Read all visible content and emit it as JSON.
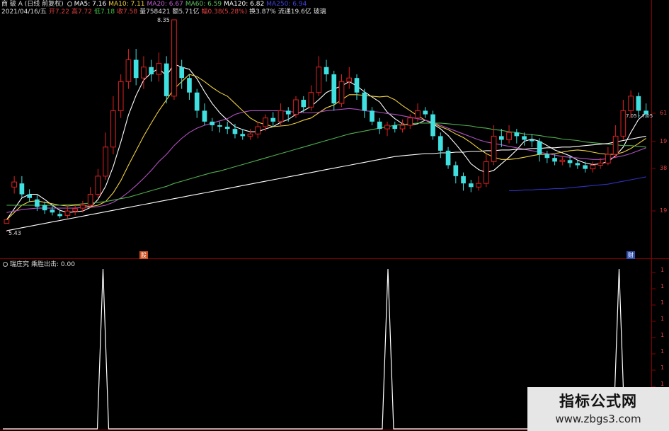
{
  "colors": {
    "background": "#000000",
    "grid": "#8b0000",
    "up": "#e02020",
    "down": "#40e0e0",
    "ma5": "#ffffff",
    "ma10": "#f0d040",
    "ma20": "#b050c0",
    "ma60": "#50b050",
    "ma120": "#ffffff",
    "ma_extra": "#3030c0",
    "indicator_line": "#ffffff"
  },
  "header": {
    "stock_name": "商 破 A (日线 前复权)",
    "ma5_label": "MA5: 7.16",
    "ma10_label": "MA10: 7.11",
    "ma20_label": "MA20: 6.67",
    "ma60_label": "MA60: 6.59",
    "ma120_label": "MA120: 6.82",
    "ma250_label": "MA250: 6.94"
  },
  "info_bar": {
    "date": "2021/04/16/五",
    "open": "开7.22",
    "high": "高7.72",
    "low": "低7.18",
    "close": "收7.58",
    "volume": "量758421",
    "amount": "额5.71亿",
    "change": "幅0.38(5.28%)",
    "turnover": "换3.87%",
    "float_cap": "流通19.6亿",
    "tag": "玻璃"
  },
  "chart_annotations": {
    "high_price": "8.35",
    "low_price": "5.43",
    "cursor_price": "7.05",
    "cursor_price_2": "7.05",
    "marker_left": "股",
    "marker_right": "财"
  },
  "price_axis": {
    "labels": [
      "61",
      "19",
      "38",
      "19"
    ]
  },
  "indicator": {
    "title": "瑞庄究",
    "sub_label": "乘胜出击: 0.00",
    "axis_labels": [
      "1",
      "1",
      "1",
      "1",
      "1",
      "1",
      "1",
      "1",
      "0"
    ]
  },
  "chart_data": {
    "type": "candlestick",
    "y_high": 8.35,
    "y_low": 5.43,
    "candles": [
      [
        5.55,
        5.6,
        5.45,
        5.43
      ],
      [
        6.05,
        6.12,
        6.2,
        5.96
      ],
      [
        6.1,
        5.95,
        6.2,
        5.9
      ],
      [
        5.95,
        5.9,
        6.02,
        5.85
      ],
      [
        5.88,
        5.78,
        5.95,
        5.72
      ],
      [
        5.8,
        5.73,
        5.85,
        5.68
      ],
      [
        5.74,
        5.7,
        5.8,
        5.66
      ],
      [
        5.68,
        5.65,
        5.74,
        5.62
      ],
      [
        5.66,
        5.72,
        5.78,
        5.62
      ],
      [
        5.72,
        5.75,
        5.8,
        5.66
      ],
      [
        5.76,
        5.8,
        5.86,
        5.7
      ],
      [
        5.8,
        5.95,
        6.05,
        5.78
      ],
      [
        5.95,
        6.2,
        6.3,
        5.9
      ],
      [
        6.2,
        6.6,
        6.8,
        6.15
      ],
      [
        6.6,
        7.1,
        7.3,
        6.5
      ],
      [
        7.1,
        7.5,
        7.6,
        7.0
      ],
      [
        7.5,
        7.8,
        7.95,
        7.4
      ],
      [
        7.8,
        7.55,
        7.95,
        7.45
      ],
      [
        7.55,
        7.7,
        7.85,
        7.4
      ],
      [
        7.7,
        7.6,
        7.8,
        7.5
      ],
      [
        7.6,
        7.75,
        7.9,
        7.5
      ],
      [
        7.75,
        7.3,
        7.85,
        7.2
      ],
      [
        7.3,
        8.35,
        8.35,
        7.25
      ],
      [
        7.7,
        7.55,
        7.8,
        7.4
      ],
      [
        7.55,
        7.35,
        7.6,
        7.25
      ],
      [
        7.35,
        7.1,
        7.4,
        7.0
      ],
      [
        7.1,
        6.95,
        7.2,
        6.9
      ],
      [
        6.95,
        6.9,
        7.0,
        6.82
      ],
      [
        6.9,
        6.88,
        6.95,
        6.8
      ],
      [
        6.88,
        6.85,
        6.95,
        6.78
      ],
      [
        6.85,
        6.78,
        6.92,
        6.72
      ],
      [
        6.78,
        6.75,
        6.85,
        6.7
      ],
      [
        6.75,
        6.78,
        6.85,
        6.7
      ],
      [
        6.78,
        6.88,
        6.95,
        6.72
      ],
      [
        6.88,
        7.0,
        7.05,
        6.82
      ],
      [
        7.0,
        6.95,
        7.08,
        6.88
      ],
      [
        6.95,
        7.1,
        7.2,
        6.9
      ],
      [
        7.1,
        7.05,
        7.15,
        6.95
      ],
      [
        7.05,
        7.25,
        7.3,
        7.0
      ],
      [
        7.25,
        7.15,
        7.3,
        7.08
      ],
      [
        7.15,
        7.35,
        7.45,
        7.1
      ],
      [
        7.35,
        7.7,
        7.85,
        7.3
      ],
      [
        7.7,
        7.6,
        7.8,
        7.5
      ],
      [
        7.6,
        7.2,
        7.65,
        7.1
      ],
      [
        7.2,
        7.5,
        7.6,
        7.15
      ],
      [
        7.5,
        7.55,
        7.7,
        7.4
      ],
      [
        7.55,
        7.35,
        7.6,
        7.25
      ],
      [
        7.35,
        7.1,
        7.4,
        7.0
      ],
      [
        7.1,
        6.95,
        7.15,
        6.9
      ],
      [
        6.95,
        6.85,
        7.0,
        6.78
      ],
      [
        6.85,
        6.9,
        6.95,
        6.75
      ],
      [
        6.9,
        6.85,
        6.95,
        6.8
      ],
      [
        6.85,
        6.9,
        6.98,
        6.8
      ],
      [
        6.9,
        7.0,
        7.05,
        6.85
      ],
      [
        7.0,
        7.1,
        7.2,
        6.95
      ],
      [
        7.1,
        7.05,
        7.15,
        7.0
      ],
      [
        7.05,
        6.75,
        7.1,
        6.7
      ],
      [
        6.75,
        6.55,
        6.8,
        6.45
      ],
      [
        6.55,
        6.35,
        6.6,
        6.3
      ],
      [
        6.35,
        6.2,
        6.4,
        6.1
      ],
      [
        6.2,
        6.1,
        6.25,
        6.0
      ],
      [
        6.1,
        6.05,
        6.15,
        5.98
      ],
      [
        6.05,
        6.1,
        6.2,
        6.0
      ],
      [
        6.1,
        6.4,
        6.5,
        6.05
      ],
      [
        6.4,
        6.75,
        6.9,
        6.35
      ],
      [
        6.75,
        6.7,
        6.85,
        6.6
      ],
      [
        6.7,
        6.8,
        6.9,
        6.65
      ],
      [
        6.8,
        6.75,
        6.85,
        6.65
      ],
      [
        6.75,
        6.7,
        6.8,
        6.62
      ],
      [
        6.7,
        6.68,
        6.78,
        6.6
      ],
      [
        6.68,
        6.5,
        6.72,
        6.4
      ],
      [
        6.5,
        6.45,
        6.55,
        6.38
      ],
      [
        6.45,
        6.4,
        6.5,
        6.35
      ],
      [
        6.4,
        6.42,
        6.48,
        6.35
      ],
      [
        6.42,
        6.38,
        6.48,
        6.32
      ],
      [
        6.38,
        6.35,
        6.42,
        6.3
      ],
      [
        6.35,
        6.3,
        6.4,
        6.25
      ],
      [
        6.3,
        6.35,
        6.4,
        6.25
      ],
      [
        6.35,
        6.38,
        6.45,
        6.3
      ],
      [
        6.38,
        6.5,
        6.6,
        6.35
      ],
      [
        6.5,
        6.75,
        6.9,
        6.45
      ],
      [
        6.75,
        7.1,
        7.25,
        6.7
      ],
      [
        7.1,
        7.3,
        7.38,
        7.0
      ],
      [
        7.3,
        7.1,
        7.35,
        7.0
      ],
      [
        7.1,
        7.05,
        7.2,
        7.0
      ]
    ],
    "ma_lines": [
      {
        "key": "ma5",
        "color": "#ffffff",
        "values": [
          5.6,
          5.75,
          5.9,
          5.95,
          5.95,
          5.88,
          5.8,
          5.73,
          5.7,
          5.71,
          5.72,
          5.77,
          5.88,
          6.06,
          6.33,
          6.67,
          7.04,
          7.31,
          7.52,
          7.62,
          7.68,
          7.58,
          7.74,
          7.7,
          7.67,
          7.54,
          7.36,
          7.2,
          7.07,
          6.97,
          6.88,
          6.84,
          6.81,
          6.81,
          6.85,
          6.88,
          6.94,
          6.98,
          7.05,
          7.1,
          7.16,
          7.25,
          7.35,
          7.4,
          7.44,
          7.5,
          7.44,
          7.36,
          7.29,
          7.22,
          7.08,
          6.99,
          6.92,
          6.9,
          6.92,
          6.97,
          6.92,
          6.85,
          6.76,
          6.64,
          6.51,
          6.37,
          6.29,
          6.25,
          6.28,
          6.37,
          6.46,
          6.56,
          6.68,
          6.71,
          6.68,
          6.62,
          6.56,
          6.52,
          6.48,
          6.42,
          6.38,
          6.36,
          6.37,
          6.4,
          6.48,
          6.6,
          6.8,
          6.98,
          7.07
        ]
      },
      {
        "key": "ma10",
        "color": "#f0d040",
        "values": [
          5.6,
          5.7,
          5.8,
          5.85,
          5.86,
          5.84,
          5.82,
          5.8,
          5.79,
          5.8,
          5.8,
          5.78,
          5.8,
          5.85,
          5.97,
          6.14,
          6.35,
          6.55,
          6.75,
          6.93,
          7.1,
          7.25,
          7.4,
          7.5,
          7.6,
          7.57,
          7.5,
          7.42,
          7.35,
          7.3,
          7.2,
          7.1,
          7.0,
          6.94,
          6.91,
          6.88,
          6.89,
          6.9,
          6.93,
          6.97,
          7.0,
          7.07,
          7.14,
          7.18,
          7.25,
          7.32,
          7.32,
          7.31,
          7.3,
          7.29,
          7.3,
          7.25,
          7.17,
          7.1,
          7.03,
          6.97,
          6.93,
          6.88,
          6.84,
          6.78,
          6.73,
          6.66,
          6.58,
          6.51,
          6.46,
          6.43,
          6.43,
          6.44,
          6.46,
          6.48,
          6.5,
          6.5,
          6.51,
          6.53,
          6.55,
          6.56,
          6.55,
          6.53,
          6.51,
          6.5,
          6.5,
          6.53,
          6.58,
          6.65,
          6.72
        ]
      },
      {
        "key": "ma20",
        "color": "#b050c0",
        "values": [
          5.7,
          5.72,
          5.74,
          5.75,
          5.76,
          5.76,
          5.76,
          5.76,
          5.76,
          5.76,
          5.77,
          5.77,
          5.78,
          5.8,
          5.84,
          5.9,
          5.98,
          6.07,
          6.17,
          6.28,
          6.4,
          6.5,
          6.62,
          6.72,
          6.8,
          6.86,
          6.9,
          6.93,
          6.96,
          6.99,
          7.05,
          7.08,
          7.1,
          7.1,
          7.1,
          7.1,
          7.1,
          7.09,
          7.08,
          7.07,
          7.07,
          7.08,
          7.1,
          7.11,
          7.12,
          7.13,
          7.12,
          7.1,
          7.09,
          7.08,
          7.06,
          7.05,
          7.03,
          7.01,
          6.99,
          6.97,
          6.94,
          6.9,
          6.86,
          6.82,
          6.78,
          6.74,
          6.7,
          6.67,
          6.65,
          6.63,
          6.61,
          6.59,
          6.57,
          6.55,
          6.53,
          6.51,
          6.49,
          6.47,
          6.46,
          6.45,
          6.44,
          6.43,
          6.43,
          6.44,
          6.46,
          6.48,
          6.51,
          6.55,
          6.59
        ]
      },
      {
        "key": "ma60",
        "color": "#50b050",
        "values": [
          5.8,
          5.8,
          5.8,
          5.8,
          5.8,
          5.8,
          5.8,
          5.8,
          5.81,
          5.81,
          5.82,
          5.83,
          5.84,
          5.85,
          5.87,
          5.89,
          5.91,
          5.94,
          5.97,
          6.0,
          6.03,
          6.06,
          6.1,
          6.13,
          6.16,
          6.19,
          6.22,
          6.25,
          6.27,
          6.3,
          6.33,
          6.36,
          6.39,
          6.42,
          6.45,
          6.48,
          6.51,
          6.54,
          6.57,
          6.6,
          6.63,
          6.66,
          6.69,
          6.72,
          6.75,
          6.78,
          6.8,
          6.82,
          6.84,
          6.86,
          6.88,
          6.9,
          6.91,
          6.92,
          6.93,
          6.93,
          6.93,
          6.93,
          6.92,
          6.91,
          6.9,
          6.89,
          6.87,
          6.86,
          6.84,
          6.83,
          6.81,
          6.8,
          6.78,
          6.77,
          6.76,
          6.74,
          6.73,
          6.71,
          6.7,
          6.69,
          6.67,
          6.66,
          6.65,
          6.64,
          6.63,
          6.62,
          6.62,
          6.61,
          6.6
        ]
      },
      {
        "key": "ma120",
        "color": "#ffffff",
        "values": [
          5.45,
          5.47,
          5.49,
          5.51,
          5.53,
          5.55,
          5.57,
          5.59,
          5.61,
          5.63,
          5.65,
          5.67,
          5.69,
          5.71,
          5.73,
          5.75,
          5.77,
          5.79,
          5.81,
          5.83,
          5.85,
          5.87,
          5.89,
          5.91,
          5.93,
          5.95,
          5.97,
          5.99,
          6.01,
          6.03,
          6.05,
          6.07,
          6.09,
          6.11,
          6.13,
          6.15,
          6.17,
          6.19,
          6.21,
          6.23,
          6.25,
          6.27,
          6.29,
          6.31,
          6.33,
          6.35,
          6.37,
          6.39,
          6.41,
          6.43,
          6.45,
          6.47,
          6.48,
          6.49,
          6.5,
          6.51,
          6.51,
          6.52,
          6.52,
          6.53,
          6.53,
          6.54,
          6.54,
          6.55,
          6.55,
          6.56,
          6.56,
          6.57,
          6.57,
          6.58,
          6.58,
          6.59,
          6.59,
          6.6,
          6.6,
          6.61,
          6.62,
          6.63,
          6.64,
          6.65,
          6.67,
          6.69,
          6.71,
          6.73,
          6.75
        ]
      },
      {
        "key": "ma_extra",
        "color": "#3030c0",
        "values": [
          null,
          null,
          null,
          null,
          null,
          null,
          null,
          null,
          null,
          null,
          null,
          null,
          null,
          null,
          null,
          null,
          null,
          null,
          null,
          null,
          null,
          null,
          null,
          null,
          null,
          null,
          null,
          null,
          null,
          null,
          null,
          null,
          null,
          null,
          null,
          null,
          null,
          null,
          null,
          null,
          null,
          null,
          null,
          null,
          null,
          null,
          null,
          null,
          null,
          null,
          null,
          null,
          null,
          null,
          null,
          null,
          null,
          null,
          null,
          null,
          null,
          null,
          null,
          null,
          null,
          null,
          6.0,
          6.0,
          6.01,
          6.01,
          6.02,
          6.02,
          6.03,
          6.03,
          6.04,
          6.05,
          6.06,
          6.07,
          6.08,
          6.09,
          6.11,
          6.13,
          6.15,
          6.17,
          6.19
        ]
      }
    ],
    "indicator": {
      "name": "乘胜出击",
      "values_range": [
        0,
        1
      ],
      "spikes_at": [
        13,
        50,
        80
      ],
      "total_points": 85
    }
  }
}
